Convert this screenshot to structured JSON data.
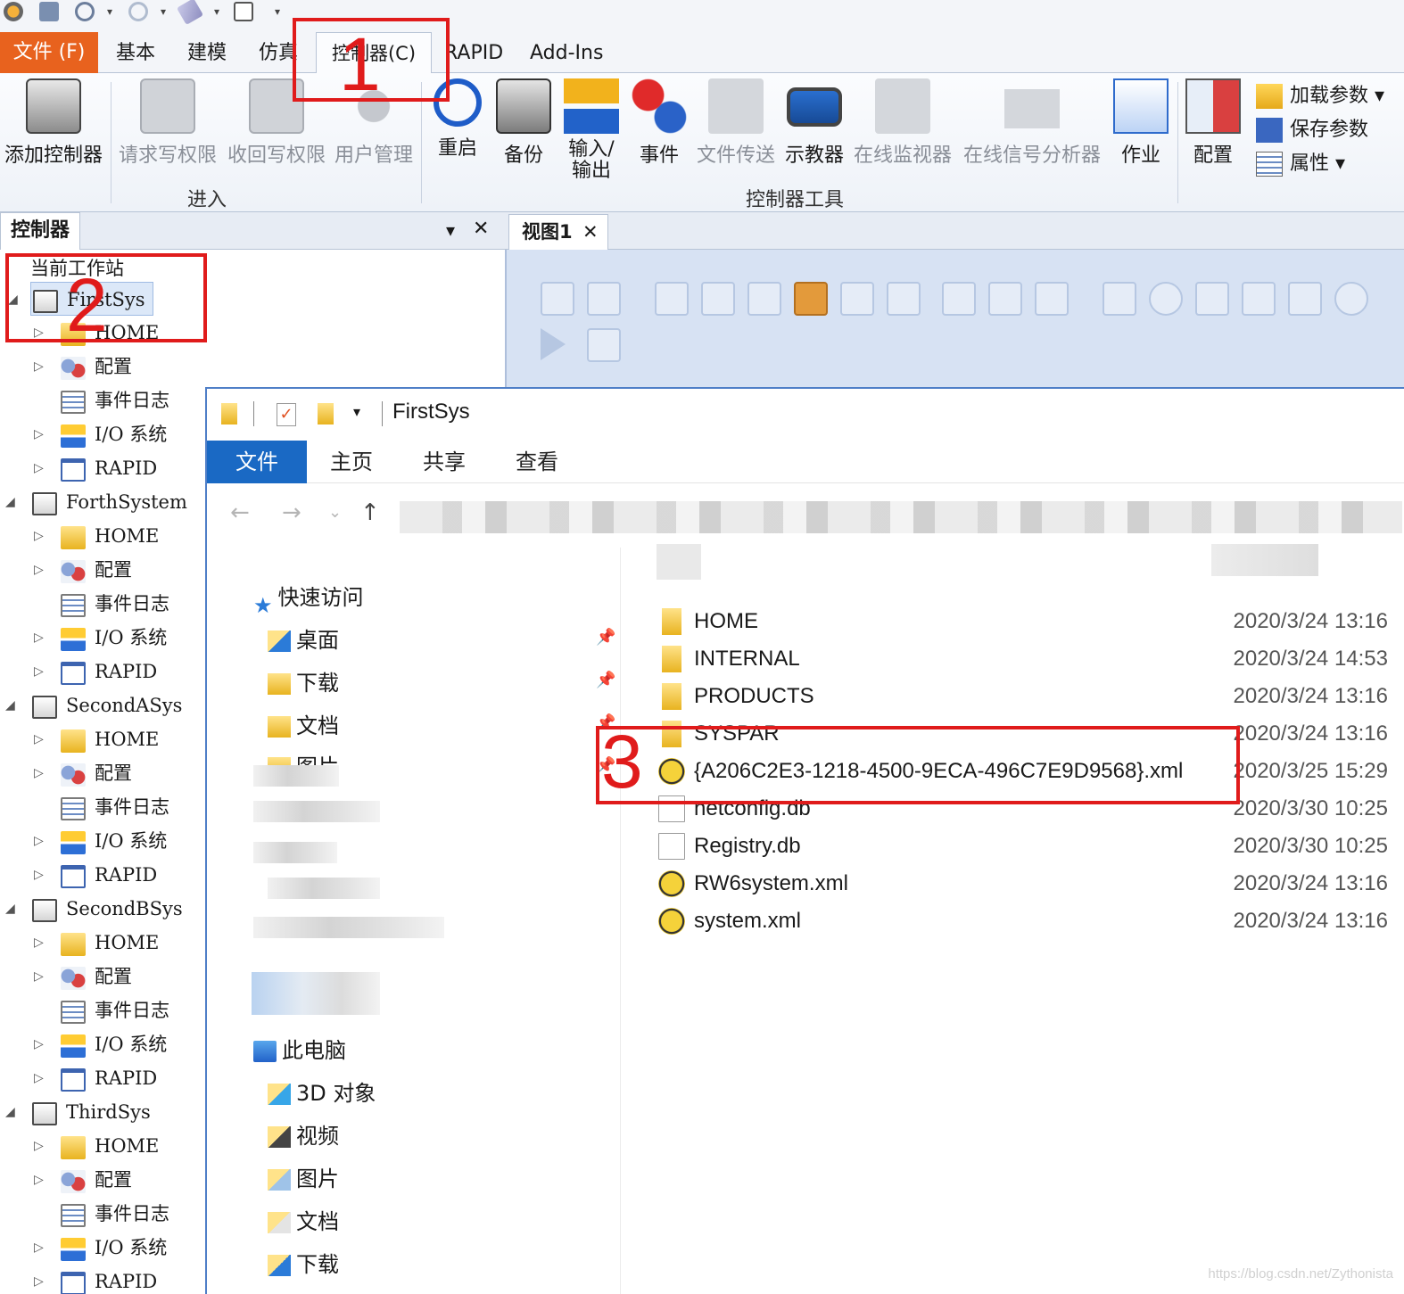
{
  "ribbon": {
    "tabs": {
      "file": "文件 (F)",
      "basic": "基本",
      "modeling": "建模",
      "simulation": "仿真",
      "controller": "控制器(C)",
      "rapid": "RAPID",
      "addins": "Add-Ins"
    },
    "buttons": {
      "add_controller": "添加控制器",
      "request_write": "请求写权限",
      "release_write": "收回写权限",
      "user_mgmt": "用户管理",
      "restart": "重启",
      "backup": "备份",
      "io_line1": "输入/",
      "io_line2": "输出",
      "events": "事件",
      "file_transfer": "文件传送",
      "teach_pendant": "示教器",
      "online_monitor": "在线监视器",
      "signal_analyzer": "在线信号分析器",
      "jobs": "作业",
      "config": "配置",
      "load_params": "加载参数",
      "save_params": "保存参数",
      "properties": "属性"
    },
    "groups": {
      "access": "进入",
      "tools": "控制器工具"
    }
  },
  "controller_panel": {
    "title": "控制器",
    "station_label": "当前工作站",
    "systems": [
      {
        "name": "FirstSys",
        "children": [
          "HOME",
          "配置",
          "事件日志",
          "I/O 系统",
          "RAPID"
        ]
      },
      {
        "name": "ForthSystem",
        "children": [
          "HOME",
          "配置",
          "事件日志",
          "I/O 系统",
          "RAPID"
        ]
      },
      {
        "name": "SecondASys",
        "children": [
          "HOME",
          "配置",
          "事件日志",
          "I/O 系统",
          "RAPID"
        ]
      },
      {
        "name": "SecondBSys",
        "children": [
          "HOME",
          "配置",
          "事件日志",
          "I/O 系统",
          "RAPID"
        ]
      },
      {
        "name": "ThirdSys",
        "children": [
          "HOME",
          "配置",
          "事件日志",
          "I/O 系统",
          "RAPID"
        ]
      }
    ]
  },
  "view_panel": {
    "tab_label": "视图1"
  },
  "explorer": {
    "title": "FirstSys",
    "tabs": {
      "file": "文件",
      "home": "主页",
      "share": "共享",
      "view": "查看"
    },
    "nav": {
      "quick_access": "快速访问",
      "quick_items": [
        "桌面",
        "下载",
        "文档",
        "图片"
      ],
      "this_pc": "此电脑",
      "pc_items": [
        "3D 对象",
        "视频",
        "图片",
        "文档",
        "下载"
      ]
    },
    "files": [
      {
        "name": "HOME",
        "date": "2020/3/24 13:16",
        "type": "folder"
      },
      {
        "name": "INTERNAL",
        "date": "2020/3/24 14:53",
        "type": "folder"
      },
      {
        "name": "PRODUCTS",
        "date": "2020/3/24 13:16",
        "type": "folder"
      },
      {
        "name": "SYSPAR",
        "date": "2020/3/24 13:16",
        "type": "folder"
      },
      {
        "name": "{A206C2E3-1218-4500-9ECA-496C7E9D9568}.xml",
        "date": "2020/3/25 15:29",
        "type": "xml"
      },
      {
        "name": "netconfig.db",
        "date": "2020/3/30 10:25",
        "type": "db"
      },
      {
        "name": "Registry.db",
        "date": "2020/3/30 10:25",
        "type": "db"
      },
      {
        "name": "RW6system.xml",
        "date": "2020/3/24 13:16",
        "type": "xml"
      },
      {
        "name": "system.xml",
        "date": "2020/3/24 13:16",
        "type": "xml"
      }
    ]
  },
  "annotations": {
    "one": "1",
    "two": "2",
    "three": "3",
    "color": "#e01b1b"
  },
  "watermark": "https://blog.csdn.net/Zythonista",
  "colors": {
    "file_tab": "#e8621e",
    "explorer_file_tab": "#1a69c4",
    "view_bg": "#d7e2f3"
  }
}
